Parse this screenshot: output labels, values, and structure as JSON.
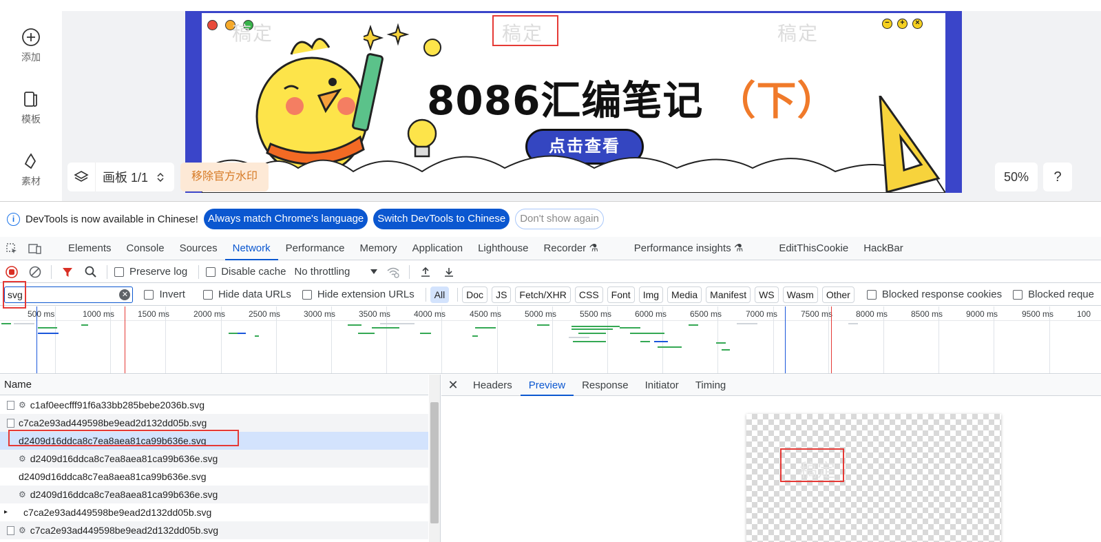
{
  "editor": {
    "rail": [
      {
        "label": "添加",
        "icon": "plus-circle-icon"
      },
      {
        "label": "模板",
        "icon": "template-icon"
      },
      {
        "label": "素材",
        "icon": "material-icon"
      }
    ],
    "banner": {
      "watermark": "稿定",
      "title": "8086汇编笔记",
      "title_suffix": "（下）",
      "cta": "点击查看"
    },
    "page_indicator": "画板 1/1",
    "remove_watermark": "移除官方水印",
    "zoom": "50%",
    "help": "?"
  },
  "devtools": {
    "infobar": {
      "message": "DevTools is now available in Chinese!",
      "btn_match": "Always match Chrome's language",
      "btn_switch": "Switch DevTools to Chinese",
      "btn_dismiss": "Don't show again"
    },
    "tabs": [
      "Elements",
      "Console",
      "Sources",
      "Network",
      "Performance",
      "Memory",
      "Application",
      "Lighthouse",
      "Recorder",
      "Performance insights",
      "EditThisCookie",
      "HackBar"
    ],
    "active_tab": "Network",
    "toolbar": {
      "preserve_log": "Preserve log",
      "disable_cache": "Disable cache",
      "throttling": "No throttling"
    },
    "filter": {
      "value": "svg",
      "invert": "Invert",
      "hide_data_urls": "Hide data URLs",
      "hide_extension_urls": "Hide extension URLs",
      "types": [
        "All",
        "Doc",
        "JS",
        "Fetch/XHR",
        "CSS",
        "Font",
        "Img",
        "Media",
        "Manifest",
        "WS",
        "Wasm",
        "Other"
      ],
      "blocked_cookies": "Blocked response cookies",
      "blocked_requests": "Blocked reque"
    },
    "timeline_ticks": [
      "500 ms",
      "1000 ms",
      "1500 ms",
      "2000 ms",
      "2500 ms",
      "3000 ms",
      "3500 ms",
      "4000 ms",
      "4500 ms",
      "5000 ms",
      "5500 ms",
      "6000 ms",
      "6500 ms",
      "7000 ms",
      "7500 ms",
      "8000 ms",
      "8500 ms",
      "9000 ms",
      "9500 ms",
      "100"
    ],
    "name_header": "Name",
    "requests": [
      {
        "name": "c1af0eecfff91f6a33bb285bebe2036b.svg",
        "icon": "file",
        "gear": true
      },
      {
        "name": "c7ca2e93ad449598be9ead2d132dd05b.svg",
        "icon": "file",
        "gear": false
      },
      {
        "name": "d2409d16ddca8c7ea8aea81ca99b636e.svg",
        "icon": "none",
        "gear": false
      },
      {
        "name": "d2409d16ddca8c7ea8aea81ca99b636e.svg",
        "icon": "none",
        "gear": true
      },
      {
        "name": "d2409d16ddca8c7ea8aea81ca99b636e.svg",
        "icon": "none",
        "gear": false
      },
      {
        "name": "d2409d16ddca8c7ea8aea81ca99b636e.svg",
        "icon": "none",
        "gear": true
      },
      {
        "name": "c7ca2e93ad449598be9ead2d132dd05b.svg",
        "icon": "none",
        "gear": false
      },
      {
        "name": "c7ca2e93ad449598be9ead2d132dd05b.svg",
        "icon": "file",
        "gear": true
      }
    ],
    "detail_tabs": [
      "Headers",
      "Preview",
      "Response",
      "Initiator",
      "Timing"
    ],
    "active_detail_tab": "Preview",
    "preview_watermark": "稿定"
  }
}
